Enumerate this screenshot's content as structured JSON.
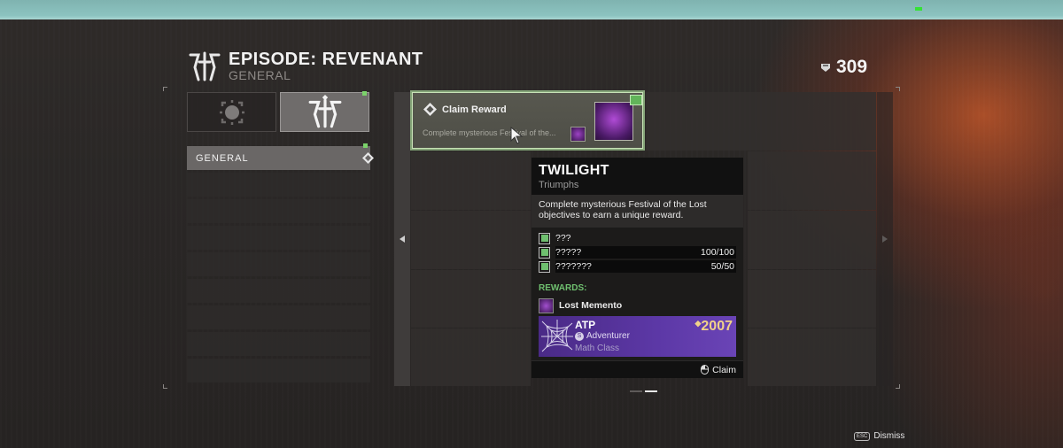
{
  "header": {
    "title": "EPISODE: REVENANT",
    "subtitle": "GENERAL",
    "currency_value": "309"
  },
  "tabs": [
    {
      "icon": "seasonal-emblem-icon",
      "active": false
    },
    {
      "icon": "revenant-logo-icon",
      "active": true
    }
  ],
  "nav": {
    "selected_label": "GENERAL"
  },
  "card": {
    "title": "Claim Reward",
    "description": "Complete mysterious Festival of the..."
  },
  "tooltip": {
    "name": "TWILIGHT",
    "type": "Triumphs",
    "description": "Complete mysterious Festival of the Lost objectives to earn a unique reward.",
    "objectives": [
      {
        "label": "???",
        "progress": ""
      },
      {
        "label": "?????",
        "progress": "100/100"
      },
      {
        "label": "???????",
        "progress": "50/50"
      }
    ],
    "rewards_label": "REWARDS:",
    "reward_item": "Lost Memento",
    "reward_emblem": {
      "name": "ATP",
      "class": "Adventurer",
      "subtitle": "Math Class",
      "power": "2007"
    },
    "footer_action": "Claim"
  },
  "footer": {
    "dismiss_label": "Dismiss",
    "dismiss_key": "ESC"
  },
  "colors": {
    "accent_green": "#6fbf6f",
    "card_border": "#85a579",
    "emblem_purple": "#5c38a6"
  }
}
